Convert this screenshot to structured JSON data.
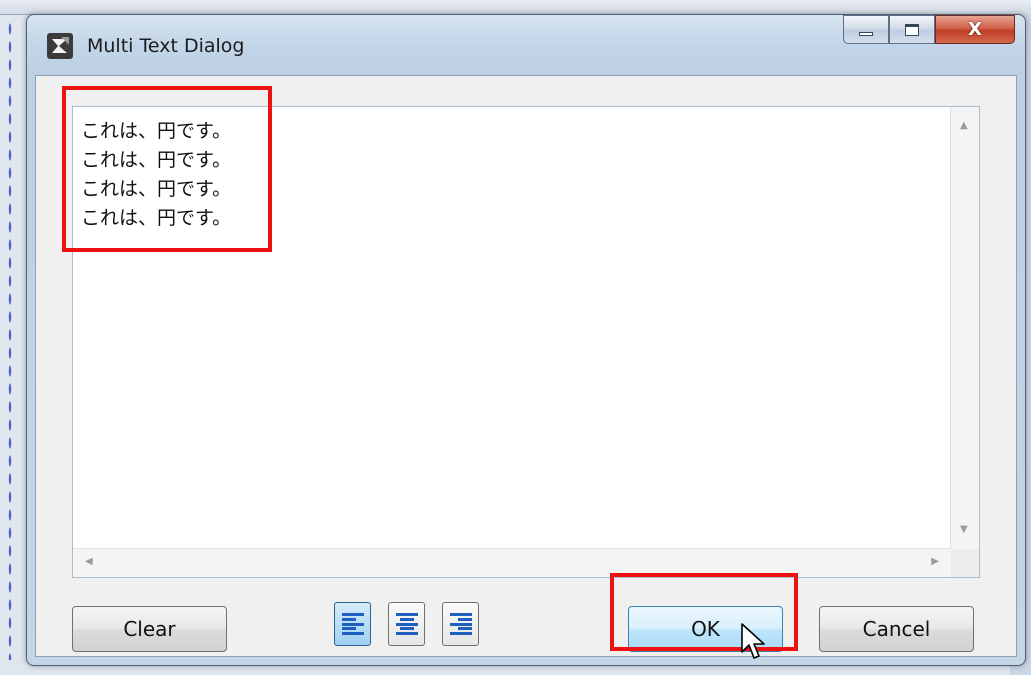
{
  "window": {
    "title": "Multi Text Dialog",
    "controls": {
      "minimize_icon": "minimize-icon",
      "maximize_icon": "maximize-icon",
      "close_glyph": "X"
    }
  },
  "editor": {
    "lines": [
      "これは、円です。",
      "これは、円です。",
      "これは、円です。",
      "これは、円です。"
    ]
  },
  "buttons": {
    "clear": "Clear",
    "ok": "OK",
    "cancel": "Cancel"
  },
  "alignment": {
    "options": [
      "align-left-icon",
      "align-center-icon",
      "align-right-icon"
    ],
    "selected": "align-left-icon"
  },
  "colors": {
    "annotation": "#ee1111",
    "align_icon": "#1e5fbf",
    "close_button": "#c8452c"
  }
}
